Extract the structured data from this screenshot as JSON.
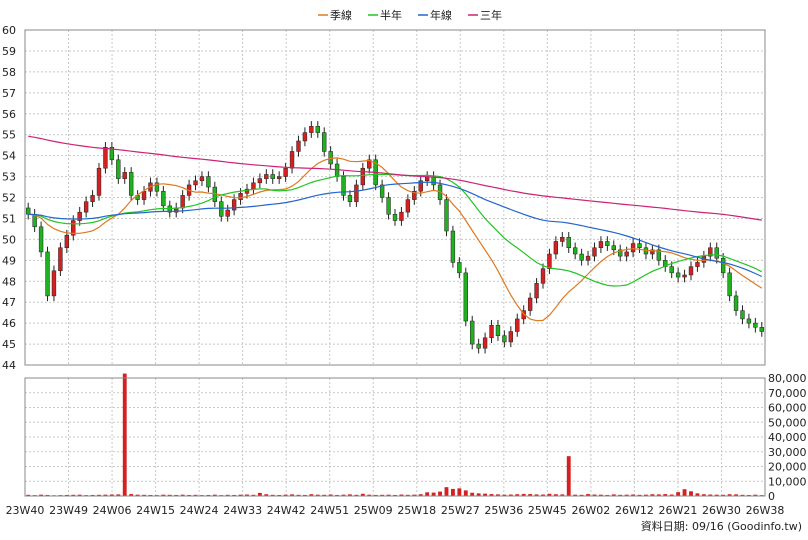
{
  "chart_data": {
    "type": "candlestick",
    "legend": {
      "placement": "top-center",
      "items": [
        {
          "name": "季線",
          "color": "#e07820"
        },
        {
          "name": "半年",
          "color": "#22c422"
        },
        {
          "name": "年線",
          "color": "#2266cc"
        },
        {
          "name": "三年",
          "color": "#cc2277"
        }
      ]
    },
    "price_axis": {
      "ylim": [
        44,
        60
      ],
      "ticks": [
        44,
        45,
        46,
        47,
        48,
        49,
        50,
        51,
        52,
        53,
        54,
        55,
        56,
        57,
        58,
        59,
        60
      ],
      "position": "left"
    },
    "volume_axis": {
      "ylim": [
        0,
        80000
      ],
      "ticks": [
        "0",
        "10,000",
        "20,000",
        "30,000",
        "40,000",
        "50,000",
        "60,000",
        "70,000",
        "80,000"
      ],
      "position": "right"
    },
    "x_ticks": [
      "23W40",
      "23W49",
      "24W06",
      "24W15",
      "24W24",
      "24W33",
      "24W42",
      "24W51",
      "25W09",
      "25W18",
      "25W27",
      "25W36",
      "25W45",
      "26W02",
      "26W12",
      "26W21",
      "26W30",
      "26W38"
    ],
    "footer": "資料日期: 09/16  (Goodinfo.tw)",
    "closes": [
      51.2,
      50.6,
      49.4,
      47.3,
      48.5,
      49.6,
      50.2,
      50.9,
      51.3,
      51.8,
      52.1,
      53.4,
      54.4,
      53.8,
      52.9,
      53.2,
      52.1,
      51.9,
      52.3,
      52.7,
      52.3,
      51.6,
      51.3,
      51.5,
      52.1,
      52.6,
      52.8,
      53.0,
      52.5,
      51.8,
      51.1,
      51.4,
      51.9,
      52.2,
      52.4,
      52.7,
      52.9,
      53.1,
      52.9,
      53.0,
      53.4,
      54.2,
      54.7,
      55.1,
      55.4,
      55.1,
      54.2,
      53.6,
      53.0,
      52.1,
      51.8,
      52.6,
      53.4,
      53.8,
      52.6,
      52.0,
      51.2,
      50.9,
      51.3,
      51.9,
      52.3,
      52.8,
      53.0,
      52.6,
      51.9,
      50.4,
      48.9,
      48.4,
      46.1,
      45.0,
      44.8,
      45.3,
      45.9,
      45.4,
      45.1,
      45.6,
      46.2,
      46.6,
      47.2,
      47.9,
      48.6,
      49.3,
      49.9,
      50.1,
      49.6,
      49.3,
      49.0,
      49.2,
      49.6,
      49.9,
      49.7,
      49.5,
      49.2,
      49.4,
      49.8,
      49.6,
      49.3,
      49.5,
      49.0,
      48.7,
      48.4,
      48.2,
      48.3,
      48.7,
      48.9,
      49.2,
      49.6,
      49.1,
      48.4,
      47.3,
      46.6,
      46.2,
      46.0,
      45.8,
      45.6
    ],
    "volumes": [
      800,
      600,
      900,
      700,
      500,
      600,
      700,
      800,
      900,
      600,
      700,
      800,
      900,
      1000,
      1100,
      83000,
      1300,
      900,
      800,
      700,
      600,
      900,
      800,
      700,
      900,
      700,
      800,
      600,
      700,
      900,
      600,
      800,
      700,
      900,
      1000,
      800,
      2100,
      1200,
      800,
      700,
      900,
      1100,
      800,
      700,
      1200,
      900,
      800,
      1000,
      700,
      900,
      1100,
      800,
      1500,
      900,
      700,
      800,
      900,
      700,
      1000,
      800,
      900,
      1200,
      2500,
      2300,
      3000,
      6000,
      4800,
      5200,
      3800,
      2200,
      1800,
      1600,
      1300,
      1100,
      900,
      1000,
      1200,
      1400,
      1300,
      1100,
      1000,
      1500,
      1200,
      1100,
      27000,
      900,
      800,
      1300,
      1000,
      900,
      700,
      1100,
      800,
      900,
      1000,
      800,
      900,
      1200,
      1100,
      1300,
      1000,
      2600,
      4600,
      3200,
      1800,
      1200,
      1000,
      900,
      800,
      1200,
      1100,
      800,
      700,
      900,
      600,
      700,
      800
    ]
  }
}
